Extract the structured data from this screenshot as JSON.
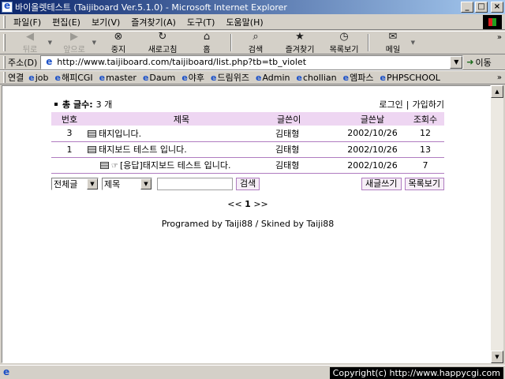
{
  "window": {
    "title": "바이올렛테스트 (Taijiboard Ver.5.1.0) - Microsoft Internet Explorer",
    "minimize": "_",
    "maximize": "□",
    "close": "×"
  },
  "menu": [
    "파일(F)",
    "편집(E)",
    "보기(V)",
    "즐겨찾기(A)",
    "도구(T)",
    "도움말(H)"
  ],
  "toolbar": {
    "back": "뒤로",
    "forward": "앞으로",
    "stop": "중지",
    "refresh": "새로고침",
    "home": "홈",
    "search": "검색",
    "favorites": "즐겨찾기",
    "history": "목록보기",
    "mail": "메일",
    "more": "»"
  },
  "address": {
    "label": "주소(D)",
    "url": "http://www.taijiboard.com/taijiboard/list.php?tb=tb_violet",
    "go": "이동"
  },
  "links": {
    "label": "연결",
    "items": [
      "job",
      "해피CGI",
      "master",
      "Daum",
      "야후",
      "드림위즈",
      "Admin",
      "chollian",
      "엠파스",
      "PHPSCHOOL"
    ],
    "more": "»"
  },
  "board": {
    "total_label": "총 글수:",
    "total_value": "3 개",
    "login": "로그인",
    "separator": "|",
    "join": "가입하기",
    "accent": "#eed6f2",
    "headers": {
      "num": "번호",
      "title": "제목",
      "author": "글쓴이",
      "date": "글쓴날",
      "hits": "조회수"
    },
    "rows": [
      {
        "num": "3",
        "title": "태지입니다.",
        "reply_prefix": "",
        "author": "김태형",
        "date": "2002/10/26",
        "hits": "12"
      },
      {
        "num": "1",
        "title": "태지보드 테스트 입니다.",
        "reply_prefix": "",
        "author": "김태형",
        "date": "2002/10/26",
        "hits": "13"
      },
      {
        "num": "",
        "title": "태지보드 테스트 입니다.",
        "reply_prefix": "[응답]",
        "author": "김태형",
        "date": "2002/10/26",
        "hits": "7"
      }
    ],
    "search_range": "전체글",
    "search_field": "제목",
    "search_value": "",
    "search_button": "검색",
    "write_button": "새글쓰기",
    "list_button": "목록보기",
    "pager_prev": "<<",
    "pager_current": "1",
    "pager_next": ">>",
    "credit": "Programed by Taiji88 / Skined by Taiji88"
  },
  "status": {
    "copyright": "Copyright(c) http://www.happycgi.com"
  }
}
